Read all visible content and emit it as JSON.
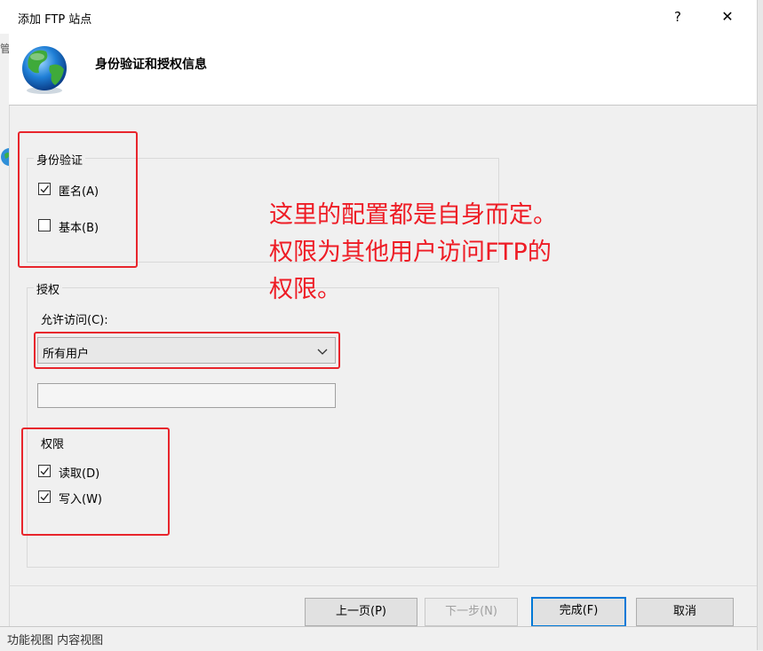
{
  "window": {
    "title": "添加 FTP 站点",
    "help_label": "?",
    "close_label": "✕"
  },
  "header": {
    "heading": "身份验证和授权信息",
    "icon": "globe-icon"
  },
  "background_window": {
    "left_fragment": "管",
    "bottom_fragment": "功能视图   内容视图"
  },
  "authentication": {
    "group_label": "身份验证",
    "anonymous": {
      "label": "匿名(A)",
      "checked": true
    },
    "basic": {
      "label": "基本(B)",
      "checked": false
    }
  },
  "authorization": {
    "group_label": "授权",
    "allow_access_label": "允许访问(C):",
    "allow_access_value": "所有用户",
    "textbox_value": ""
  },
  "permissions": {
    "group_label": "权限",
    "read": {
      "label": "读取(D)",
      "checked": true
    },
    "write": {
      "label": "写入(W)",
      "checked": true
    }
  },
  "annotation": {
    "lines": [
      "这里的配置都是自身而定。",
      "权限为其他用户访问FTP的",
      "权限。"
    ],
    "color": "#ee1c25"
  },
  "buttons": {
    "previous": "上一页(P)",
    "next": "下一步(N)",
    "finish": "完成(F)",
    "cancel": "取消"
  },
  "colors": {
    "accent": "#0078d7",
    "annotation_red": "#e8252c"
  }
}
